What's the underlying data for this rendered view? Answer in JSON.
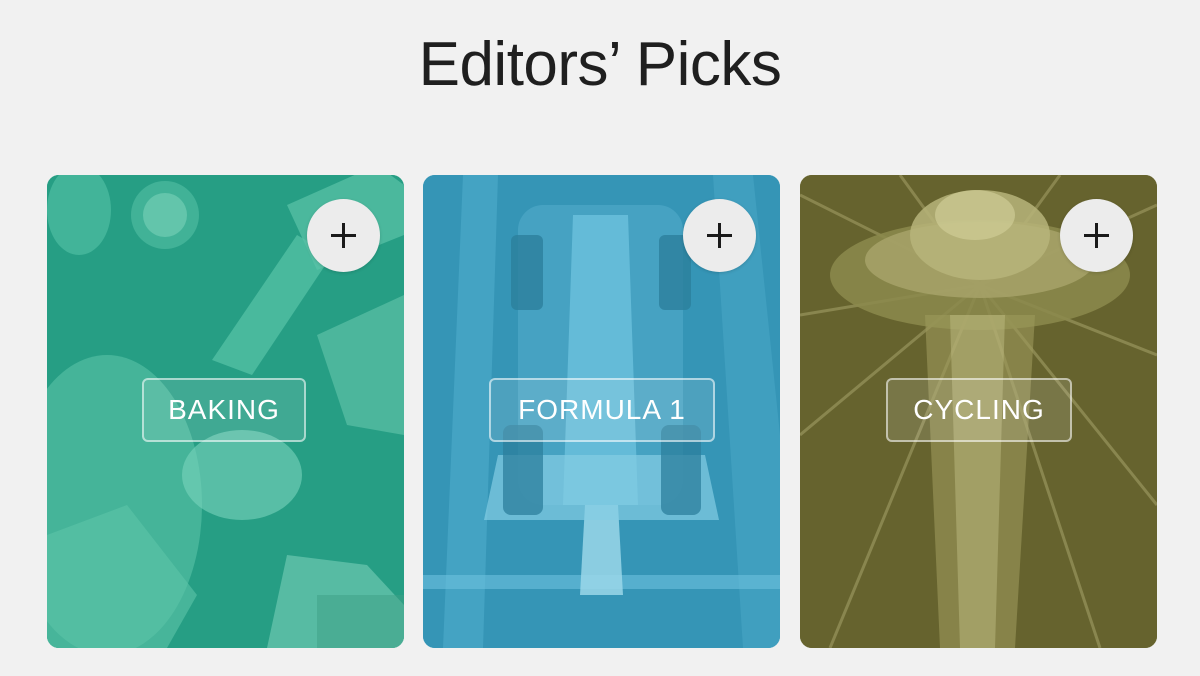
{
  "page": {
    "title": "Editors’ Picks"
  },
  "cards": [
    {
      "label": "BAKING",
      "color": "#2aa58a",
      "add_icon": "plus-icon"
    },
    {
      "label": "FORMULA 1",
      "color": "#3a9fc1",
      "add_icon": "plus-icon"
    },
    {
      "label": "CYCLING",
      "color": "#6f6c33",
      "add_icon": "plus-icon"
    }
  ],
  "colors": {
    "background": "#f1f1f1",
    "add_button": "#ececec"
  }
}
